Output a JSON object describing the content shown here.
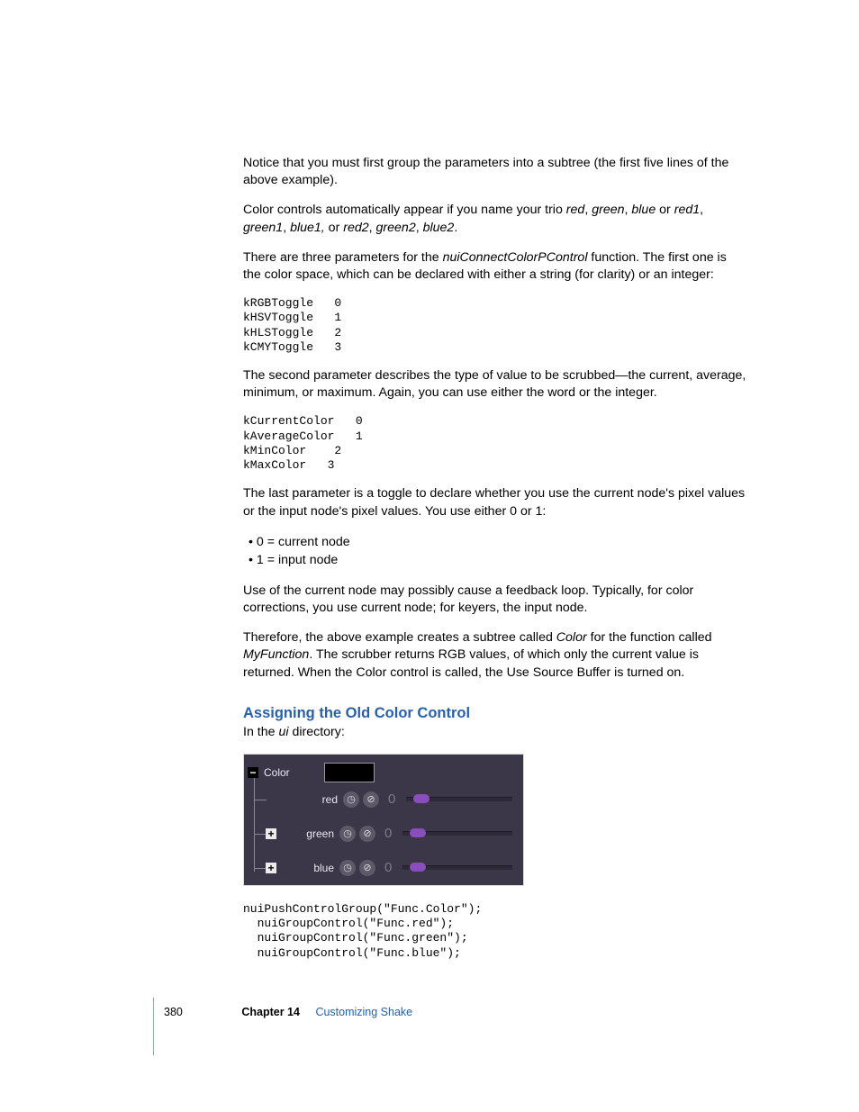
{
  "para1": "Notice that you must first group the parameters into a subtree (the first five lines of the above example).",
  "para2_a": "Color controls automatically appear if you name your trio ",
  "para2_red": "red",
  "para2_c1": ", ",
  "para2_green": "green",
  "para2_c2": ", ",
  "para2_blue": "blue",
  "para2_or": " or ",
  "para2_red1": "red1",
  "para2_c3": ", ",
  "para2_green1": "green1",
  "para2_c4": ", ",
  "para2_blue1": "blue1,",
  "para2_orb": " or ",
  "para2_red2": "red2",
  "para2_c5": ", ",
  "para2_green2": "green2",
  "para2_c6": ", ",
  "para2_blue2": "blue2",
  "para2_end": ".",
  "para3_a": "There are three parameters for the ",
  "para3_fn": "nuiConnectColorPControl",
  "para3_b": " function. The first one is the color space, which can be declared with either a string (for clarity) or an integer:",
  "code1": "kRGBToggle   0\nkHSVToggle   1\nkHLSToggle   2\nkCMYToggle   3",
  "para4": "The second parameter describes the type of value to be scrubbed—the current, average, minimum, or maximum. Again, you can use either the word or the integer.",
  "code2": "kCurrentColor   0\nkAverageColor   1\nkMinColor    2\nkMaxColor   3",
  "para5": "The last parameter is a toggle to declare whether you use the current node's pixel values or the input node's pixel values. You use either 0 or 1:",
  "bullets": {
    "b0": "0 = current node",
    "b1": "1 = input node"
  },
  "para6": "Use of the current node may possibly cause a feedback loop. Typically, for color corrections, you use current node; for keyers, the input node.",
  "para7_a": "Therefore, the above example creates a subtree called ",
  "para7_color": "Color",
  "para7_b": " for the function called ",
  "para7_fn": "MyFunction",
  "para7_c": ". The scrubber returns RGB values, of which only the current value is returned. When the Color control is called, the Use Source Buffer is turned on.",
  "section_title": "Assigning the Old Color Control",
  "para8_a": "In the ",
  "para8_ui": "ui",
  "para8_b": " directory:",
  "shot": {
    "group_label": "Color",
    "rows": {
      "r0": {
        "label": "red",
        "value": "0"
      },
      "r1": {
        "label": "green",
        "value": "0"
      },
      "r2": {
        "label": "blue",
        "value": "0"
      }
    },
    "icons": {
      "clock": "◷",
      "key": "⊘"
    }
  },
  "code3": "nuiPushControlGroup(\"Func.Color\");\n  nuiGroupControl(\"Func.red\");\n  nuiGroupControl(\"Func.green\");\n  nuiGroupControl(\"Func.blue\");",
  "footer": {
    "page": "380",
    "chapter": "Chapter 14",
    "title": "Customizing Shake"
  }
}
